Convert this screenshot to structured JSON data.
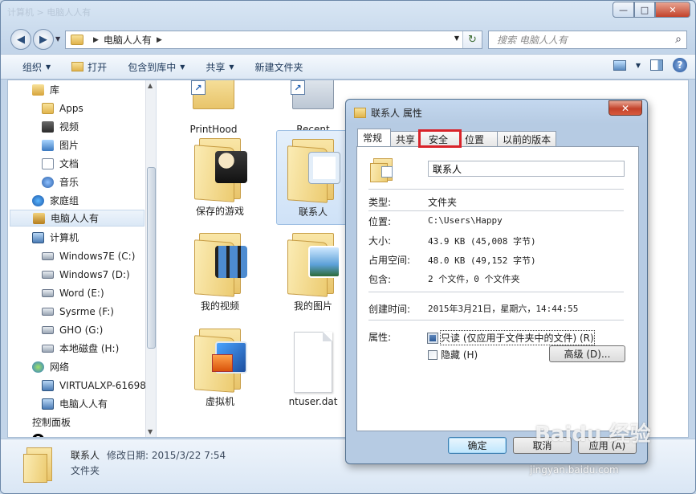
{
  "window": {
    "title_ghost": "计算机 > 电脑人人有",
    "controls": {
      "minimize": "—",
      "maximize": "□",
      "close": "✕"
    }
  },
  "nav": {
    "back": "◀",
    "forward": "▶",
    "address_path": "电脑人人有",
    "search_placeholder": "搜索 电脑人人有"
  },
  "toolbar": {
    "organize": "组织",
    "open": "打开",
    "include_library": "包含到库中",
    "share": "共享",
    "new_folder": "新建文件夹"
  },
  "sidebar": {
    "items": [
      {
        "label": "库",
        "icon": "library-icon",
        "indent": 0
      },
      {
        "label": "Apps",
        "icon": "folder-icon",
        "indent": 1
      },
      {
        "label": "视频",
        "icon": "video-library-icon",
        "indent": 1
      },
      {
        "label": "图片",
        "icon": "picture-library-icon",
        "indent": 1
      },
      {
        "label": "文档",
        "icon": "document-library-icon",
        "indent": 1
      },
      {
        "label": "音乐",
        "icon": "music-library-icon",
        "indent": 1
      },
      {
        "label": "家庭组",
        "icon": "homegroup-icon",
        "indent": 0
      },
      {
        "label": "电脑人人有",
        "icon": "user-folder-icon",
        "indent": 0,
        "selected": true
      },
      {
        "label": "计算机",
        "icon": "computer-icon",
        "indent": 0
      },
      {
        "label": "Windows7E (C:)",
        "icon": "drive-icon",
        "indent": 1
      },
      {
        "label": "Windows7 (D:)",
        "icon": "drive-icon",
        "indent": 1
      },
      {
        "label": "Word (E:)",
        "icon": "drive-icon",
        "indent": 1
      },
      {
        "label": "Sysrme (F:)",
        "icon": "drive-icon",
        "indent": 1
      },
      {
        "label": "GHO (G:)",
        "icon": "drive-icon",
        "indent": 1
      },
      {
        "label": "本地磁盘 (H:)",
        "icon": "drive-icon",
        "indent": 1
      },
      {
        "label": "网络",
        "icon": "network-icon",
        "indent": 0
      },
      {
        "label": "VIRTUALXP-61698",
        "icon": "computer-icon",
        "indent": 1
      },
      {
        "label": "电脑人人有",
        "icon": "computer-icon",
        "indent": 1
      },
      {
        "label": "控制面板",
        "icon": "control-panel-icon",
        "indent": 0
      }
    ]
  },
  "files": {
    "items": [
      {
        "label": "PrintHood",
        "kind": "folder-shortcut"
      },
      {
        "label": "Recent",
        "kind": "folder-shortcut"
      },
      {
        "label": "保存的游戏",
        "kind": "folder-games"
      },
      {
        "label": "联系人",
        "kind": "folder-contacts",
        "selected": true
      },
      {
        "label": "我的视频",
        "kind": "folder-videos"
      },
      {
        "label": "我的图片",
        "kind": "folder-pictures"
      },
      {
        "label": "虚拟机",
        "kind": "folder-vm"
      },
      {
        "label": "ntuser.dat",
        "kind": "file"
      }
    ]
  },
  "details": {
    "name": "联系人",
    "modified": "修改日期: 2015/3/22 7:54",
    "type": "文件夹"
  },
  "dialog": {
    "title": "联系人 属性",
    "close": "✕",
    "tabs": [
      "常规",
      "共享",
      "安全",
      "位置",
      "以前的版本"
    ],
    "active_tab": "常规",
    "highlighted_tab": "安全",
    "name_value": "联系人",
    "props": {
      "type_label": "类型:",
      "type_value": "文件夹",
      "location_label": "位置:",
      "location_value": "C:\\Users\\Happy",
      "size_label": "大小:",
      "size_value": "43.9 KB (45,008 字节)",
      "disk_label": "占用空间:",
      "disk_value": "48.0 KB (49,152 字节)",
      "contains_label": "包含:",
      "contains_value": "2 个文件，0 个文件夹",
      "created_label": "创建时间:",
      "created_value": "2015年3月21日，星期六，14:44:55",
      "attr_label": "属性:"
    },
    "readonly_label": "只读 (仅应用于文件夹中的文件) (R)",
    "readonly_checked": true,
    "hidden_label": "隐藏 (H)",
    "hidden_checked": false,
    "advanced_button": "高级 (D)...",
    "ok_button": "确定",
    "cancel_button": "取消",
    "apply_button": "应用 (A)"
  },
  "watermark": {
    "text": "Baidu 经验",
    "url": "jingyan.baidu.com"
  }
}
